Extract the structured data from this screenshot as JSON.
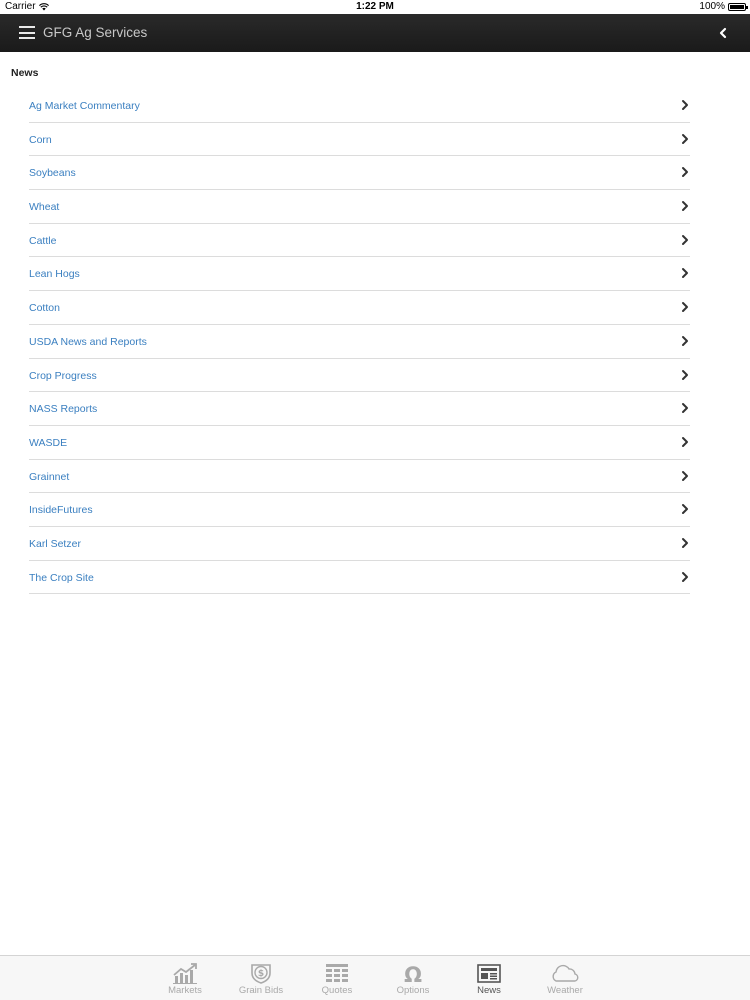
{
  "status_bar": {
    "carrier": "Carrier",
    "time": "1:22 PM",
    "battery": "100%"
  },
  "nav": {
    "title": "GFG Ag Services"
  },
  "section": {
    "title": "News"
  },
  "news_items": [
    "Ag Market Commentary",
    "Corn",
    "Soybeans",
    "Wheat",
    "Cattle",
    "Lean Hogs",
    "Cotton",
    "USDA News and Reports",
    "Crop Progress",
    "NASS Reports",
    "WASDE",
    "Grainnet",
    "InsideFutures",
    "Karl Setzer",
    "The Crop Site"
  ],
  "tabs": [
    {
      "label": "Markets",
      "icon": "chart-icon"
    },
    {
      "label": "Grain Bids",
      "icon": "dollar-badge-icon"
    },
    {
      "label": "Quotes",
      "icon": "grid-icon"
    },
    {
      "label": "Options",
      "icon": "omega-icon"
    },
    {
      "label": "News",
      "icon": "newspaper-icon",
      "active": true
    },
    {
      "label": "Weather",
      "icon": "cloud-icon"
    }
  ],
  "colors": {
    "link": "#3a7fc0",
    "nav_bg": "#1f1f1f",
    "tab_inactive": "#a9a9a9",
    "tab_active": "#555555"
  }
}
